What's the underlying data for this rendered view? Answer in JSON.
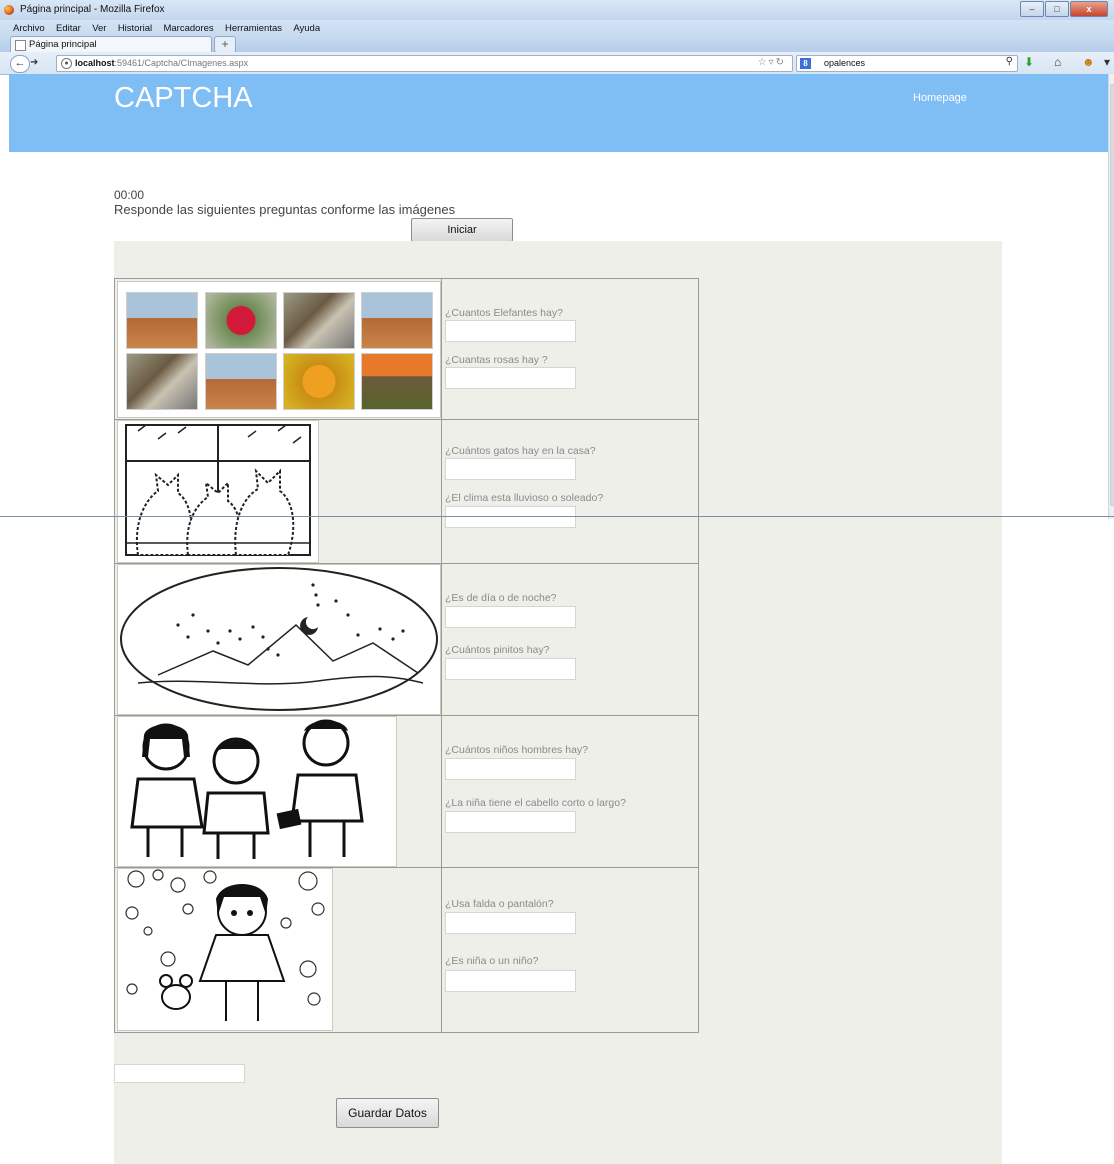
{
  "window": {
    "title": "Página principal - Mozilla Firefox"
  },
  "menu": [
    "Archivo",
    "Editar",
    "Ver",
    "Historial",
    "Marcadores",
    "Herramientas",
    "Ayuda"
  ],
  "tab": {
    "label": "Página principal",
    "new_tab": "+"
  },
  "nav": {
    "url_host": "localhost",
    "url_rest": ":59461/Captcha/CImagenes.aspx",
    "search_value": "opalences"
  },
  "header": {
    "logo": "CAPTCHA",
    "home_link": "Homepage"
  },
  "main": {
    "timer": "00:00",
    "instructions": "Responde las siguientes preguntas conforme las imágenes",
    "start_button": "Iniciar",
    "save_button": "Guardar Datos",
    "bottom_field_value": ""
  },
  "questions": [
    {
      "image": "photo-grid: elephants, rose, sparrows, starfish",
      "q1": "¿Cuantos Elefantes hay?",
      "q2": "¿Cuantas rosas hay ?"
    },
    {
      "image": "three cats at rainy window drawing",
      "q1": "¿Cuántos gatos hay en la casa?",
      "q2": "¿El clima esta lluvioso o soleado?"
    },
    {
      "image": "night mountain landscape drawing",
      "q1": "¿Es de día o de noche?",
      "q2": "¿Cuántos pinitos hay?"
    },
    {
      "image": "three children drawing",
      "q1": "¿Cuántos niños hombres hay?",
      "q2": "¿La niña tiene el cabello corto o largo?"
    },
    {
      "image": "girl with bubbles and mouse drawing",
      "q1": "¿Usa falda o pantalón?",
      "q2": "¿Es niña o un niño?"
    }
  ],
  "icons": {
    "window_controls": [
      "minimize-icon",
      "maximize-icon",
      "close-icon"
    ],
    "nav": [
      "back-icon",
      "forward-icon",
      "globe-icon",
      "bookmark-star-icon",
      "reload-icon",
      "search-icon",
      "download-icon",
      "home-icon",
      "addon-icon"
    ]
  },
  "colors": {
    "header_bg": "#7fbdf5",
    "panel_bg": "#efefe9",
    "label_color": "#8a8a8a"
  }
}
